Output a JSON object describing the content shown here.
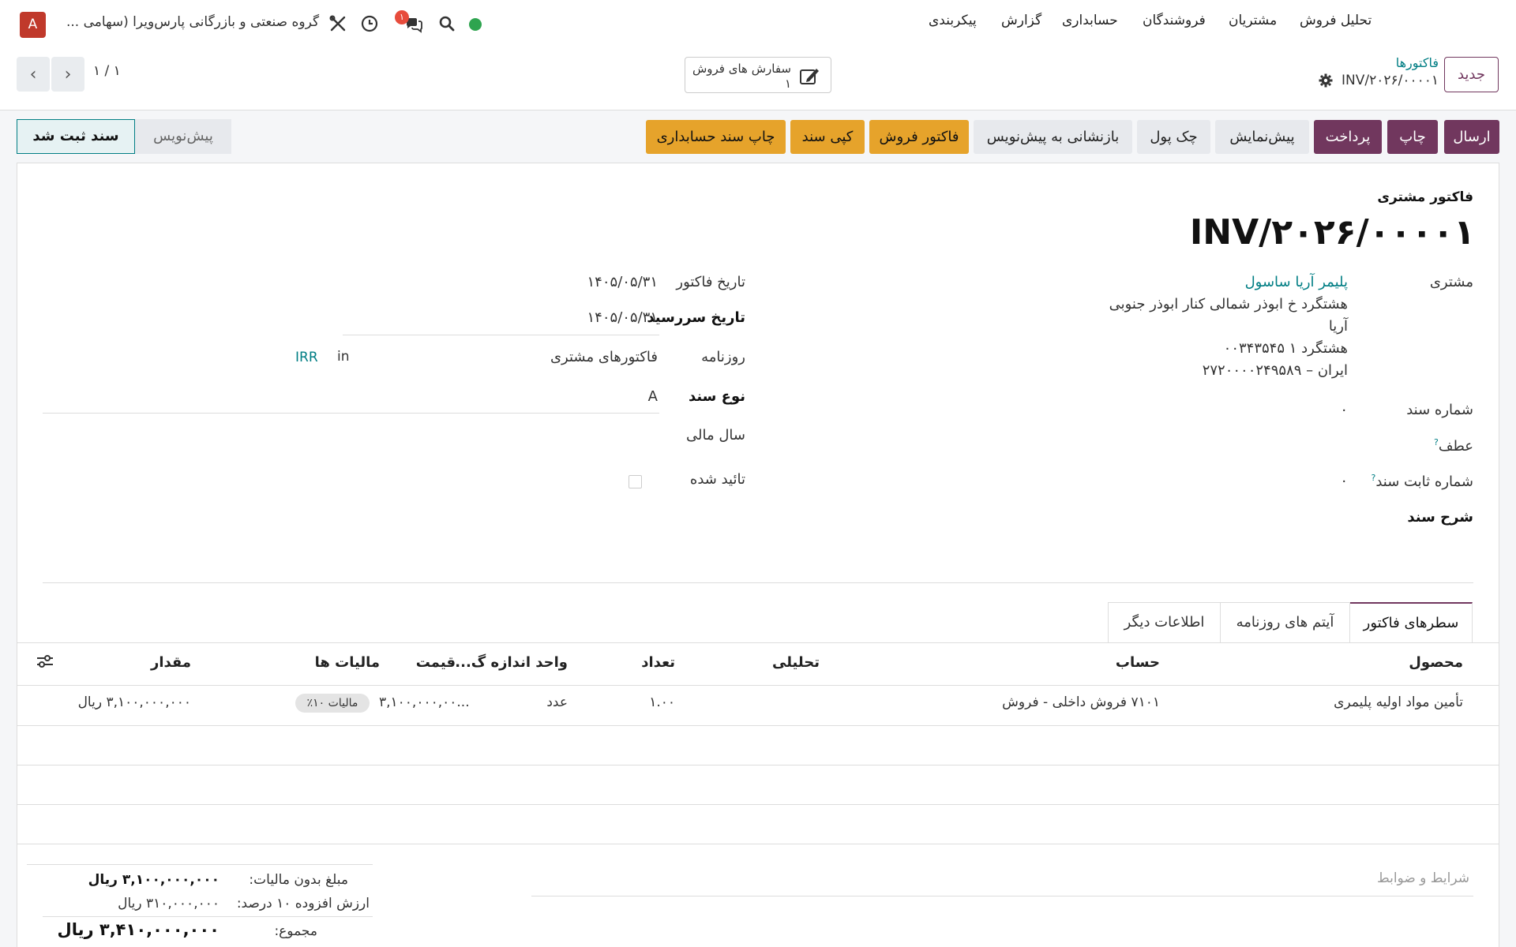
{
  "topbar": {
    "avatar_letter": "A",
    "company": "گروه صنعتی و بازرگانی پارس‌ویرا (سهامی ...",
    "notification_count": "۱",
    "menu": [
      "تحلیل فروش",
      "مشتریان",
      "فروشندگان",
      "حسابداری",
      "گزارش",
      "پیکربندی"
    ]
  },
  "control": {
    "pager": "۱ / ۱",
    "smart_button_label": "سفارش های فروش",
    "smart_button_count": "۱",
    "new_label": "جدید",
    "breadcrumb_parent": "فاکتورها",
    "breadcrumb_current": "INV/۲۰۲۶/۰۰۰۰۱"
  },
  "actions": {
    "send": "ارسال",
    "print": "چاپ",
    "pay": "پرداخت",
    "preview": "پیش‌نمایش",
    "check": "چک پول",
    "reset_draft": "بازنشانی به پیش‌نویس",
    "sales_invoice": "فاکتور فروش",
    "copy_doc": "کپی سند",
    "print_voucher": "چاپ سند حسابداری"
  },
  "status": {
    "draft": "پیش‌نویس",
    "posted": "سند ثبت شد"
  },
  "form": {
    "doc_type": "فاکتور مشتری",
    "number": "INV/۲۰۲۶/۰۰۰۰۱",
    "customer_label": "مشتری",
    "customer_name": "پلیمر آریا ساسول",
    "address_1": "هشتگرد خ ابوذر شمالی کنار ابوذر جنوبی",
    "address_2": "آریا",
    "address_3": "هشتگرد ۱ ۰۰۳۴۳۵۴۵",
    "address_4": "ایران – ۲۷۲۰۰۰۰۲۴۹۵۸۹",
    "doc_no_label": "شماره سند",
    "doc_no_value": "۰",
    "ref_label": "عطف",
    "fixed_no_label": "شماره ثابت سند",
    "fixed_no_value": "۰",
    "desc_label": "شرح سند",
    "invoice_date_label": "تاریخ فاکتور",
    "invoice_date": "۱۴۰۵/۰۵/۳۱",
    "due_date_label": "تاریخ سررسید",
    "due_date": "۱۴۰۵/۰۵/۳۱",
    "journal_label": "روزنامه",
    "journal_value": "فاکتورهای مشتری",
    "journal_in": "in",
    "currency": "IRR",
    "doc_kind_label": "نوع سند",
    "doc_kind_value": "A",
    "fiscal_year_label": "سال مالی",
    "approved_label": "تائید شده"
  },
  "tabs": [
    "سطرهای فاکتور",
    "آیتم های روزنامه",
    "اطلاعات دیگر"
  ],
  "lines": {
    "headers": {
      "product": "محصول",
      "account": "حساب",
      "analytic": "تحلیلی",
      "qty": "تعداد",
      "uom": "واحد اندازه گ...",
      "price": "قیمت",
      "taxes": "مالیات ها",
      "amount": "مقدار"
    },
    "row": {
      "product": "تأمین مواد اولیه پلیمری",
      "account": "۷۱۰۱ فروش داخلی - فروش",
      "qty": "۱.۰۰",
      "uom": "عدد",
      "price": "۳,۱۰۰,۰۰۰,۰۰...",
      "tax": "مالیات ۱۰٪",
      "amount": "۳,۱۰۰,۰۰۰,۰۰۰ ریال"
    }
  },
  "terms_placeholder": "شرایط و ضوابط",
  "totals": {
    "untaxed_label": "مبلغ بدون مالیات:",
    "untaxed_value": "۳,۱۰۰,۰۰۰,۰۰۰ ریال",
    "vat_label": "ارزش افزوده ۱۰ درصد:",
    "vat_value": "۳۱۰,۰۰۰,۰۰۰ ریال",
    "total_label": "مجموع:",
    "total_value": "۳,۴۱۰,۰۰۰,۰۰۰ ریال"
  },
  "colors": {
    "primary": "#71375e",
    "link": "#017e84",
    "warn": "#e6a32b",
    "danger": "#c0392b"
  }
}
